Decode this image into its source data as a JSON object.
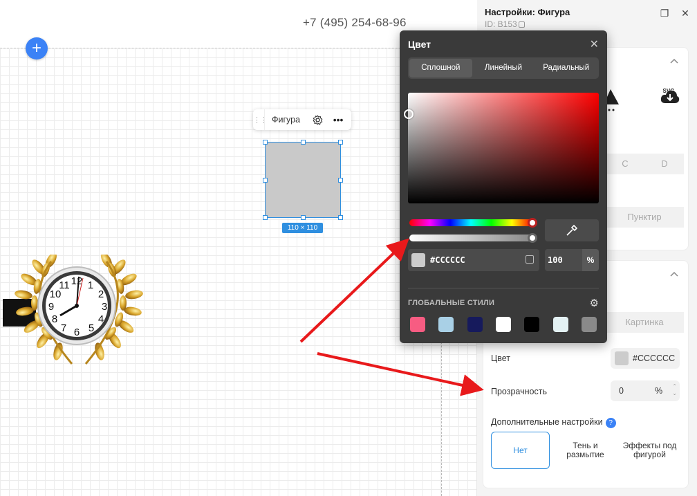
{
  "canvas": {
    "phone": "+7 (495) 254-68-96",
    "add_button": "+",
    "shape_toolbar": {
      "label": "Фигура"
    },
    "size_tag": "110 × 110"
  },
  "panel": {
    "title": "Настройки: Фигура",
    "id": "ID: B153",
    "download_label": "SVG",
    "seg_a": "C",
    "seg_b": "D",
    "dash": "Пунктир",
    "picture": "Картинка",
    "color_label": "Цвет",
    "color_value": "#CCCCCC",
    "transparency_label": "Прозрачность",
    "transparency_value": "0",
    "transparency_unit": "%",
    "advanced_label": "Дополнительные настройки",
    "help": "?",
    "options": [
      {
        "label": "Нет"
      },
      {
        "label": "Тень и размытие"
      },
      {
        "label": "Эффекты под фигурой"
      }
    ]
  },
  "color_popup": {
    "title": "Цвет",
    "tabs": [
      "Сплошной",
      "Линейный",
      "Радиальный"
    ],
    "hex": "#CCCCCC",
    "opacity": "100",
    "opacity_unit": "%",
    "global_styles_label": "ГЛОБАЛЬНЫЕ СТИЛИ",
    "global_swatches": [
      "#f75c82",
      "#a9d0e6",
      "#161a5c",
      "#ffffff",
      "#000000",
      "#e3f1f3",
      "#8a8a8a"
    ]
  }
}
